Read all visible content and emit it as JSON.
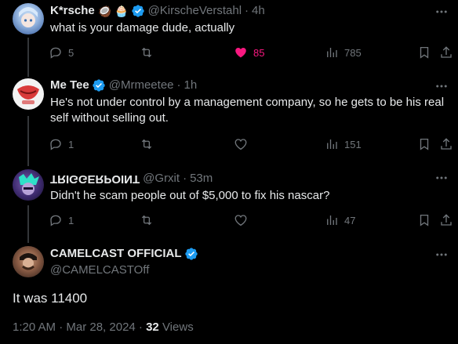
{
  "replies": [
    {
      "name": "K*rsche",
      "emojis": [
        "🥥",
        "🧁"
      ],
      "handle": "@KirscheVerstahl",
      "time": "4h",
      "text": "what is your damage dude, actually",
      "replies": "5",
      "retweets": "",
      "likes": "85",
      "liked": true,
      "views": "785"
    },
    {
      "name": "Me Tee",
      "handle": "@Mrmeetee",
      "time": "1h",
      "text": "He's not under control by a management company, so he gets to be his real self without selling out.",
      "replies": "1",
      "retweets": "",
      "likes": "",
      "views": "151"
    },
    {
      "name": "TRIGGERPOINT",
      "handle": "@Grxit",
      "time": "53m",
      "text": "Didn't he scam people out of $5,000 to fix his nascar?",
      "replies": "1",
      "retweets": "",
      "likes": "",
      "views": "47"
    }
  ],
  "main_post": {
    "name": "CAMELCAST OFFICIAL",
    "handle": "@CAMELCASTOff",
    "text": "It was 11400",
    "timestamp": "1:20 AM · Mar 28, 2024 · ",
    "views_count": "32",
    "views_label": " Views"
  },
  "separator": "·",
  "colors": {
    "background": "#000000",
    "text": "#e7e9ea",
    "muted": "#71767b",
    "verified": "#1d9bf0",
    "like": "#f91880",
    "thread_line": "#333639"
  }
}
